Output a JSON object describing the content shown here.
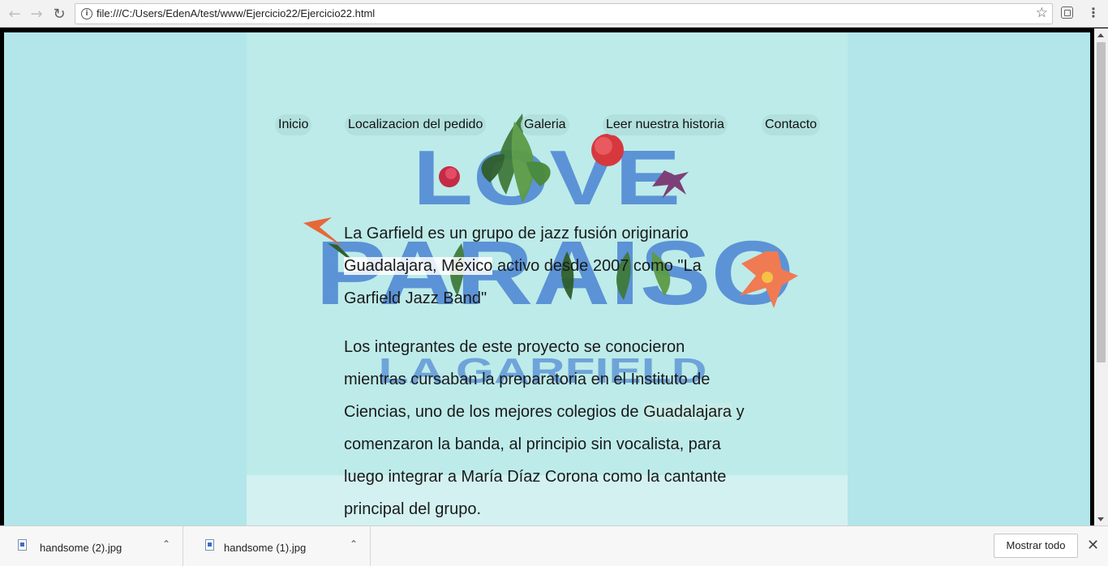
{
  "browser": {
    "url": "file:///C:/Users/EdenA/test/www/Ejercicio22/Ejercicio22.html",
    "icons": {
      "back": "arrow-left-icon",
      "forward": "arrow-right-icon",
      "reload": "reload-icon",
      "info": "info-icon",
      "bookmark": "star-icon",
      "extension": "extension-icon",
      "menu": "kebab-menu-icon"
    }
  },
  "page": {
    "hero_text": {
      "love": "LOVE",
      "paraiso": "PARAISO",
      "band": "LA GARFIELD"
    },
    "nav": [
      {
        "label": "Inicio"
      },
      {
        "label": "Localizacion del pedido"
      },
      {
        "label": "Galeria"
      },
      {
        "label": "Leer nuestra historia"
      },
      {
        "label": "Contacto"
      }
    ],
    "paragraphs": {
      "p1_a": "La Garfield es un grupo de jazz fusión originario ",
      "p1_highlight": "Guadalajara, México",
      "p1_b": " activo desde 2007 como \"La Garfield Jazz Band\"",
      "p2_a": "Los integrantes de este proyecto se conocieron mientras cursaban la preparatoria en el Instituto de Ciencias, uno de los mejores colegios de ",
      "p2_highlight": "Guadalajara",
      "p2_b": " y comenzaron la banda, al principio sin vocalista, para luego integrar a María Díaz Corona como la cantante principal del grupo."
    },
    "colors": {
      "background": "#b2e6ea",
      "column": "#bdebe9",
      "hero_letters": "#5b93d6"
    }
  },
  "downloads": {
    "items": [
      {
        "name": "handsome (2).jpg"
      },
      {
        "name": "handsome (1).jpg"
      }
    ],
    "show_all_label": "Mostrar todo"
  }
}
